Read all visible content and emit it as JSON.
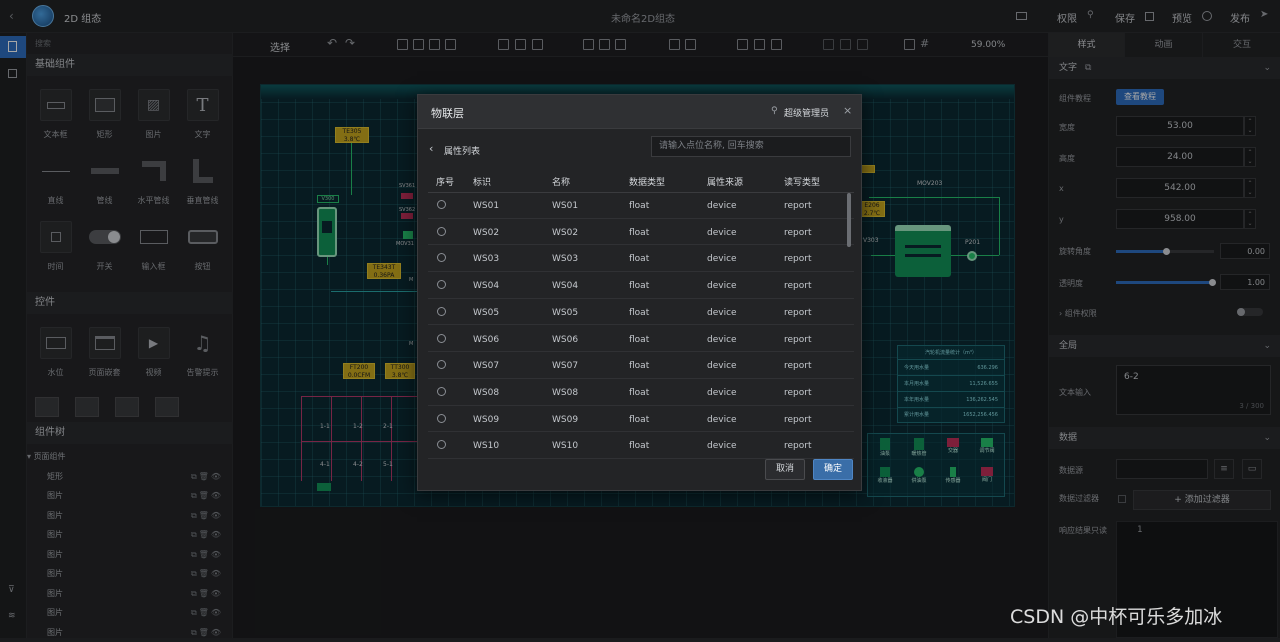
{
  "app": {
    "title": "2D 组态",
    "doc_title": "未命名2D组态",
    "actions": {
      "perm": "权限",
      "save": "保存",
      "preview": "预览",
      "publish": "发布"
    }
  },
  "left": {
    "search_placeholder": "搜索",
    "basic_title": "基础组件",
    "basic": [
      "文本框",
      "矩形",
      "图片",
      "文字",
      "直线",
      "管线",
      "水平管线",
      "垂直管线",
      "时间",
      "开关",
      "输入框",
      "按钮"
    ],
    "controls_title": "控件",
    "controls": [
      "水位",
      "页面嵌套",
      "视频",
      "告警提示"
    ],
    "tree_title": "组件树",
    "tree_root": "页面组件",
    "tree_items": [
      "矩形",
      "图片",
      "图片",
      "图片",
      "图片",
      "图片",
      "图片",
      "图片",
      "图片"
    ]
  },
  "toolbar": {
    "select": "选择",
    "zoom": "59.00%"
  },
  "right": {
    "tabs": [
      "样式",
      "动画",
      "交互"
    ],
    "text_label": "文字",
    "tutorial_label": "组件教程",
    "tutorial_btn": "查看教程",
    "width_label": "宽度",
    "width": "53.00",
    "height_label": "高度",
    "height": "24.00",
    "x_label": "x",
    "x": "542.00",
    "y_label": "y",
    "y": "958.00",
    "rotate_label": "旋转角度",
    "rotate": "0.00",
    "opacity_label": "透明度",
    "opacity": "1.00",
    "opacity_level": 1.0,
    "perm_label": "组件权限",
    "global_title": "全局",
    "text_input_label": "文本输入",
    "text_value": "6-2",
    "text_count": "3 / 300",
    "data_title": "数据",
    "source_label": "数据源",
    "filter_label": "数据过滤器",
    "add_filter": "+ 添加过滤器",
    "response_label": "响应结果只读",
    "line_no": "1"
  },
  "scada": {
    "tags": [
      "TE305",
      "3.8℃",
      "TE343T",
      "0.36PA",
      "FT200",
      "0.0CFM",
      "TT300",
      "3.8℃",
      "V300",
      "SV361",
      "SV362",
      "MOV31",
      "MOV203",
      "P201",
      "V303",
      "E206",
      "2.7℃",
      "M",
      "M"
    ],
    "labels": [
      "1-1",
      "1-2",
      "2-1",
      "4-1",
      "4-2",
      "5-1"
    ],
    "table_title": "汽轮机流量统计（m³）",
    "table_rows": [
      [
        "今天用水量",
        "636.296"
      ],
      [
        "本月用水量",
        "11,526.655"
      ],
      [
        "本年用水量",
        "136,262.545"
      ],
      [
        "累计用水量",
        "1652,256.456"
      ]
    ],
    "legend": [
      "油泵",
      "暖热管",
      "交器",
      "调节阀",
      "收液器",
      "供油泵",
      "传感器",
      "阀门"
    ]
  },
  "modal": {
    "title": "物联层",
    "user": "超级管理员",
    "back_label": "属性列表",
    "search_placeholder": "请输入点位名称, 回车搜索",
    "headers": [
      "序号",
      "标识",
      "名称",
      "数据类型",
      "属性来源",
      "读写类型"
    ],
    "rows": [
      [
        "WS01",
        "WS01",
        "float",
        "device",
        "report"
      ],
      [
        "WS02",
        "WS02",
        "float",
        "device",
        "report"
      ],
      [
        "WS03",
        "WS03",
        "float",
        "device",
        "report"
      ],
      [
        "WS04",
        "WS04",
        "float",
        "device",
        "report"
      ],
      [
        "WS05",
        "WS05",
        "float",
        "device",
        "report"
      ],
      [
        "WS06",
        "WS06",
        "float",
        "device",
        "report"
      ],
      [
        "WS07",
        "WS07",
        "float",
        "device",
        "report"
      ],
      [
        "WS08",
        "WS08",
        "float",
        "device",
        "report"
      ],
      [
        "WS09",
        "WS09",
        "float",
        "device",
        "report"
      ],
      [
        "WS10",
        "WS10",
        "float",
        "device",
        "report"
      ]
    ],
    "cancel": "取消",
    "ok": "确定"
  },
  "watermark": "CSDN @中杯可乐多加冰",
  "colors": {
    "accent": "#2f6fc2",
    "ok_btn": "#3a6ea8",
    "scada_bg": "#0b2a33",
    "tag": "#c9a91f",
    "pipe_green": "#27c46e",
    "pipe_pink": "#b73a6a"
  }
}
